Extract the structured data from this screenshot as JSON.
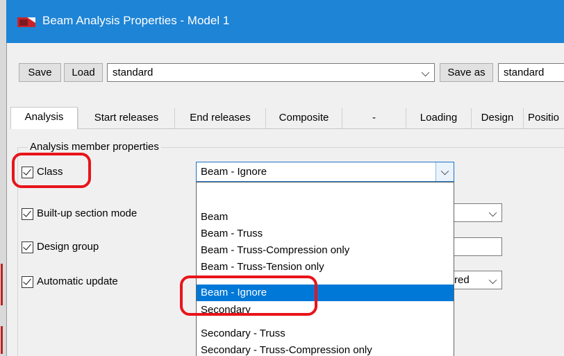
{
  "window": {
    "title": "Beam Analysis Properties - Model 1",
    "accent": "#1e84d6"
  },
  "toolbar": {
    "save_label": "Save",
    "load_label": "Load",
    "preset_value": "standard",
    "save_as_label": "Save as",
    "save_as_value": "standard"
  },
  "tabs": [
    {
      "label": "Analysis",
      "active": true
    },
    {
      "label": "Start releases"
    },
    {
      "label": "End releases"
    },
    {
      "label": "Composite"
    },
    {
      "label": "-"
    },
    {
      "label": "Loading"
    },
    {
      "label": "Design"
    },
    {
      "label": "Positio"
    }
  ],
  "group": {
    "title": "Analysis member properties"
  },
  "rows": {
    "class": {
      "label": "Class",
      "checked": true,
      "value": "Beam - Ignore"
    },
    "built_up": {
      "label": "Built-up section mode",
      "checked": true
    },
    "design_group": {
      "label": "Design group",
      "checked": true
    },
    "auto_update": {
      "label": "Automatic update",
      "checked": true,
      "partial_value": "red"
    }
  },
  "dropdown": {
    "options": [
      "",
      "Beam",
      "Beam - Truss",
      "Beam - Truss-Compression only",
      "Beam - Truss-Tension only",
      "Beam - Ignore",
      "Secondary",
      "Secondary - Truss",
      "Secondary - Truss-Compression only"
    ],
    "selected_index": 5,
    "highlight_color": "#0078d7"
  },
  "annotation_color": "#e8141a"
}
